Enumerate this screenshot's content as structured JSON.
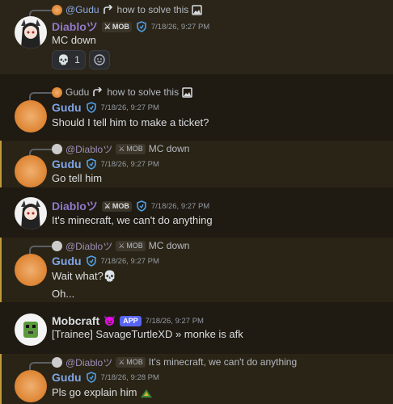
{
  "messages": [
    {
      "reply": {
        "name": "@Gudu",
        "text": "how to solve this"
      },
      "author": "Diabloツ",
      "tag": "MOB",
      "time": "7/18/26, 9:27 PM",
      "content": "MC down",
      "reactions": [
        {
          "emoji": "skull",
          "count": "1"
        },
        {
          "emoji": "add-reaction"
        }
      ]
    },
    {
      "reply": {
        "name": "Gudu",
        "text": "how to solve this"
      },
      "author": "Gudu",
      "time": "7/18/26, 9:27 PM",
      "content": "Should I tell him to make a ticket?"
    },
    {
      "reply": {
        "name": "@Diabloツ",
        "tag": "MOB",
        "text": "MC down"
      },
      "author": "Gudu",
      "time": "7/18/26, 9:27 PM",
      "content": "Go tell him"
    },
    {
      "author": "Diabloツ",
      "tag": "MOB",
      "time": "7/18/26, 9:27 PM",
      "content": "It's minecraft, we can't do anything"
    },
    {
      "reply": {
        "name": "@Diabloツ",
        "tag": "MOB",
        "text": "MC down"
      },
      "author": "Gudu",
      "time": "7/18/26, 9:27 PM",
      "content": "Wait what?",
      "followup": "Oh..."
    },
    {
      "author": "Mobcraft",
      "app_tag": "APP",
      "time": "7/18/26, 9:27 PM",
      "content": "[Trainee] SavageTurtleXD » monke is afk"
    },
    {
      "reply": {
        "name": "@Diabloツ",
        "tag": "MOB",
        "text": "It's minecraft, we can't do anything"
      },
      "author": "Gudu",
      "time": "7/18/26, 9:28 PM",
      "content": "Pls go explain him"
    }
  ],
  "colors": {
    "diablo_name": "#8f79c9",
    "gudu_name": "#7fa6e8",
    "highlight_bar": "#c19a3a",
    "app_badge": "#5865f2"
  }
}
